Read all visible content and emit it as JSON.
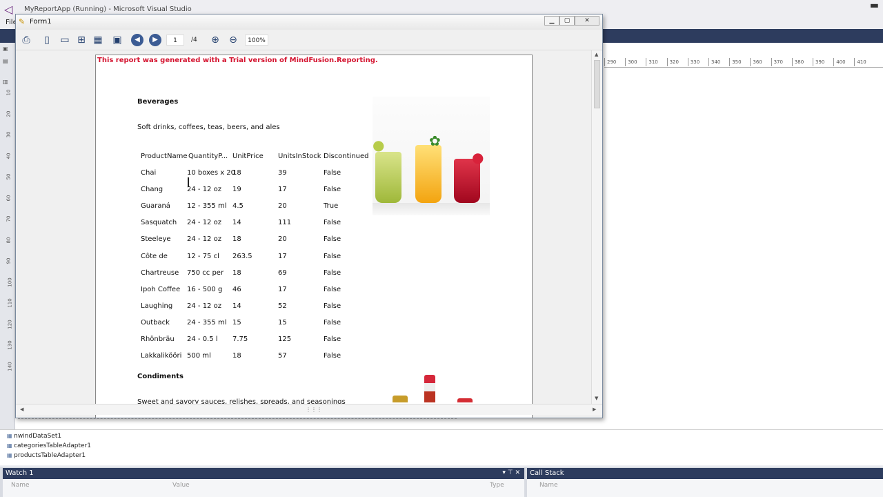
{
  "vs": {
    "title": "MyReportApp (Running) - Microsoft Visual Studio",
    "menu_first": "File",
    "ruler_top": [
      "290",
      "300",
      "310",
      "320",
      "330",
      "340",
      "350",
      "360",
      "370",
      "380",
      "390",
      "400",
      "410"
    ],
    "ruler_left": [
      "10",
      "20",
      "30",
      "40",
      "50",
      "60",
      "70",
      "80",
      "90",
      "100",
      "110",
      "120",
      "130",
      "140"
    ],
    "tray": [
      "nwindDataSet1",
      "categoriesTableAdapter1",
      "productsTableAdapter1"
    ],
    "watch": {
      "title": "Watch 1",
      "columns": [
        "Name",
        "Value",
        "Type"
      ]
    },
    "callstack": {
      "title": "Call Stack",
      "columns": [
        "Name"
      ]
    }
  },
  "form": {
    "title": "Form1",
    "toolbar": {
      "page": "1",
      "page_total": "/4",
      "zoom": "100%"
    }
  },
  "report": {
    "trial_notice": "This report was generated with a Trial version of MindFusion.Reporting.",
    "columns": [
      "ProductName",
      "QuantityP...",
      "UnitPrice",
      "UnitsInStock",
      "Discontinued"
    ],
    "categories": [
      {
        "name": "Beverages",
        "description": "Soft drinks, coffees, teas, beers, and ales",
        "rows": [
          [
            "Chai",
            "10 boxes x 20",
            "18",
            "39",
            "False"
          ],
          [
            "Chang",
            "24 - 12 oz",
            "19",
            "17",
            "False"
          ],
          [
            "Guaraná",
            "12 - 355 ml",
            "4.5",
            "20",
            "True"
          ],
          [
            "Sasquatch",
            "24 - 12 oz",
            "14",
            "111",
            "False"
          ],
          [
            "Steeleye",
            "24 - 12 oz",
            "18",
            "20",
            "False"
          ],
          [
            "Côte de",
            "12 - 75 cl",
            "263.5",
            "17",
            "False"
          ],
          [
            "Chartreuse",
            "750 cc per",
            "18",
            "69",
            "False"
          ],
          [
            "Ipoh Coffee",
            "16 - 500 g",
            "46",
            "17",
            "False"
          ],
          [
            "Laughing",
            "24 - 12 oz",
            "14",
            "52",
            "False"
          ],
          [
            "Outback",
            "24 - 355 ml",
            "15",
            "15",
            "False"
          ],
          [
            "Rhönbräu",
            "24 - 0.5 l",
            "7.75",
            "125",
            "False"
          ],
          [
            "Lakkalikööri",
            "500 ml",
            "18",
            "57",
            "False"
          ]
        ]
      },
      {
        "name": "Condiments",
        "description": "Sweet and savory sauces, relishes, spreads, and seasonings"
      }
    ]
  }
}
